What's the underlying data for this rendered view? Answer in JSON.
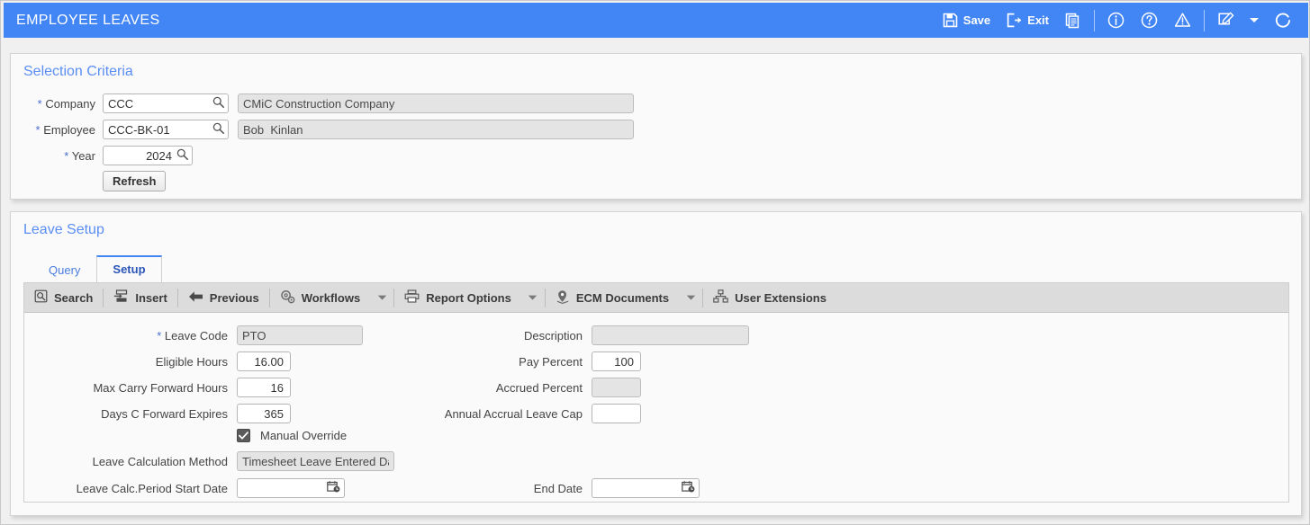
{
  "app": {
    "title": "EMPLOYEE LEAVES",
    "accent": "#4285f4"
  },
  "titlebar_actions": [
    {
      "name": "save-button",
      "label": "Save",
      "icon": "save-icon"
    },
    {
      "name": "exit-button",
      "label": "Exit",
      "icon": "exit-icon"
    },
    {
      "name": "copy-button",
      "label": "",
      "icon": "copy-documents-icon"
    },
    {
      "name": "info-button",
      "label": "",
      "icon": "info-circle-icon"
    },
    {
      "name": "help-button",
      "label": "",
      "icon": "help-circle-icon"
    },
    {
      "name": "warning-button",
      "label": "",
      "icon": "warning-triangle-icon"
    },
    {
      "name": "notes-button",
      "label": "",
      "icon": "note-edit-icon"
    },
    {
      "name": "notes-dropdown",
      "label": "",
      "icon": "chevron-down-icon"
    },
    {
      "name": "refresh-button",
      "label": "",
      "icon": "refresh-circle-icon"
    }
  ],
  "selection_criteria": {
    "title": "Selection Criteria",
    "company": {
      "label": "Company",
      "required": "*",
      "value": "CCC",
      "description": "CMiC Construction Company"
    },
    "employee": {
      "label": "Employee",
      "required": "*",
      "value": "CCC-BK-01",
      "description": "Bob  Kinlan"
    },
    "year": {
      "label": "Year",
      "required": "*",
      "value": "2024"
    },
    "refresh_label": "Refresh"
  },
  "leave_setup": {
    "title": "Leave Setup",
    "tabs": [
      {
        "label": "Query",
        "active": false
      },
      {
        "label": "Setup",
        "active": true
      }
    ],
    "action_bar": [
      {
        "label": "Search",
        "icon": "search-icon",
        "caret": false
      },
      {
        "label": "Insert",
        "icon": "insert-icon",
        "caret": false
      },
      {
        "label": "Previous",
        "icon": "previous-arrow-icon",
        "caret": false
      },
      {
        "label": "Workflows",
        "icon": "workflows-gear-icon",
        "caret": true
      },
      {
        "label": "Report Options",
        "icon": "printer-icon",
        "caret": true
      },
      {
        "label": "ECM Documents",
        "icon": "ecm-pin-icon",
        "caret": true
      },
      {
        "label": "User Extensions",
        "icon": "user-extensions-icon",
        "caret": false
      }
    ],
    "fields": {
      "leave_code": {
        "label": "Leave Code",
        "required": "*",
        "value": "PTO",
        "disabled": true
      },
      "description": {
        "label": "Description",
        "value": "",
        "disabled": true
      },
      "eligible_hours": {
        "label": "Eligible Hours",
        "value": "16.00",
        "disabled": false
      },
      "pay_percent": {
        "label": "Pay Percent",
        "value": "100",
        "disabled": false
      },
      "max_carry_forward_hours": {
        "label": "Max Carry Forward Hours",
        "value": "16",
        "disabled": false
      },
      "accrued_percent": {
        "label": "Accrued Percent",
        "value": "",
        "disabled": true
      },
      "days_c_forward_expires": {
        "label": "Days C Forward Expires",
        "value": "365",
        "disabled": false
      },
      "annual_accrual_leave_cap": {
        "label": "Annual Accrual Leave Cap",
        "value": "",
        "disabled": false
      },
      "manual_override": {
        "label": "Manual Override",
        "checked": true
      },
      "leave_calculation_method": {
        "label": "Leave Calculation Method",
        "value": "Timesheet Leave Entered Date",
        "disabled": true
      },
      "leave_calc_period_start_date": {
        "label": "Leave Calc.Period Start Date",
        "value": ""
      },
      "end_date": {
        "label": "End Date",
        "value": ""
      }
    }
  }
}
